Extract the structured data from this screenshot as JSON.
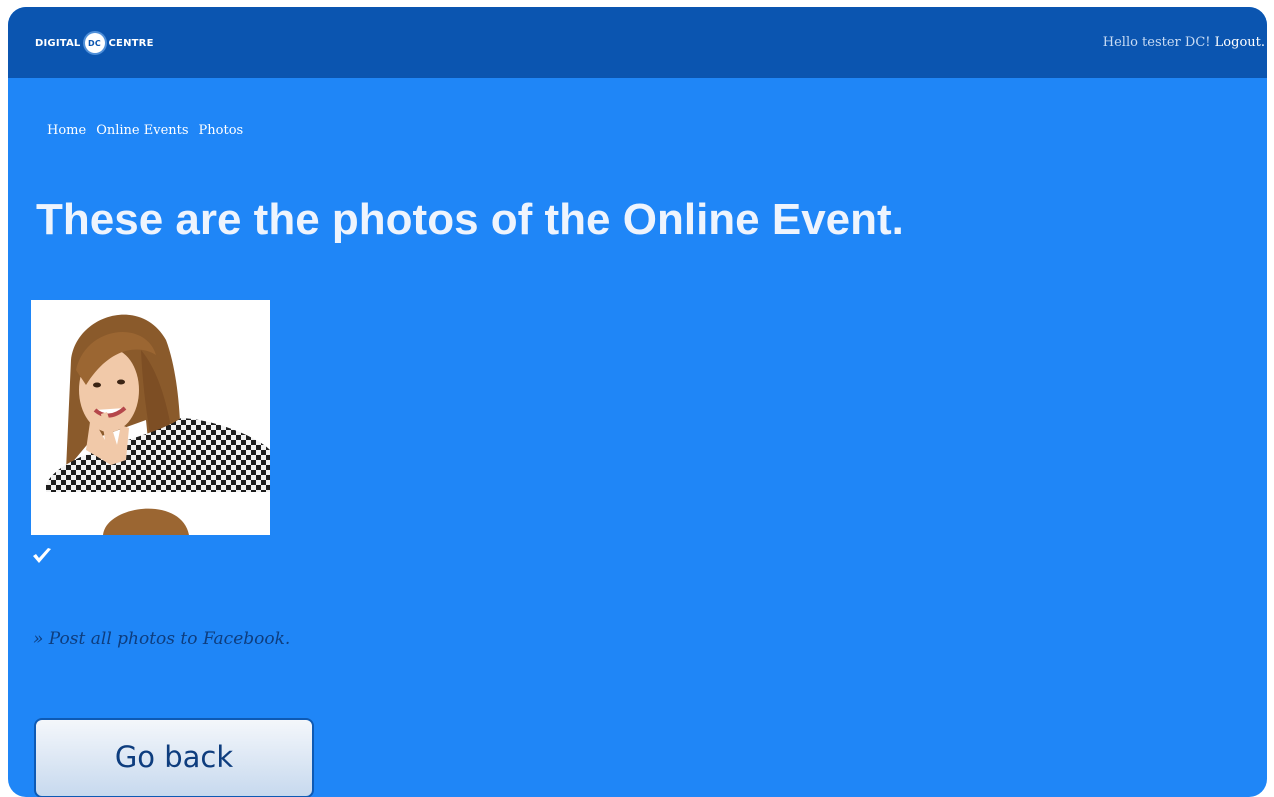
{
  "header": {
    "logo_left": "DIGITAL",
    "logo_badge": "DC",
    "logo_right": "CENTRE",
    "greeting": "Hello tester DC!",
    "logout_label": "Logout."
  },
  "breadcrumb": {
    "items": [
      "Home",
      "Online Events",
      "Photos"
    ]
  },
  "main": {
    "title": "These are the photos of the Online Event.",
    "photo_selected": true,
    "post_link": "» Post all photos to Facebook.",
    "go_back_label": "Go back"
  },
  "colors": {
    "page_bg": "#1f86f7",
    "header_bg": "#0b55b0",
    "link_dark": "#0e3d7e"
  },
  "icons": [
    "dc-logo-icon",
    "checkmark-icon"
  ]
}
